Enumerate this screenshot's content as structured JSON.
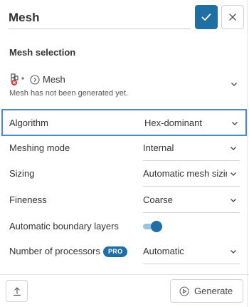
{
  "header": {
    "title": "Mesh",
    "confirm_icon": "check-icon",
    "close_icon": "close-icon"
  },
  "mesh_selection": {
    "title": "Mesh selection",
    "mesh_name": "Mesh",
    "status_note": "Mesh has not been generated yet.",
    "status_color": "#d6343b"
  },
  "properties": {
    "algorithm": {
      "label": "Algorithm",
      "value": "Hex-dominant"
    },
    "meshing_mode": {
      "label": "Meshing mode",
      "value": "Internal"
    },
    "sizing": {
      "label": "Sizing",
      "value": "Automatic mesh sizing"
    },
    "fineness": {
      "label": "Fineness",
      "value": "Coarse"
    },
    "boundary_layers": {
      "label": "Automatic boundary layers",
      "enabled": true
    },
    "processors": {
      "label": "Number of processors",
      "badge": "PRO",
      "value": "Automatic"
    }
  },
  "footer": {
    "generate_label": "Generate"
  },
  "colors": {
    "accent": "#1f6fa5",
    "highlight_border": "#4a88d0"
  }
}
